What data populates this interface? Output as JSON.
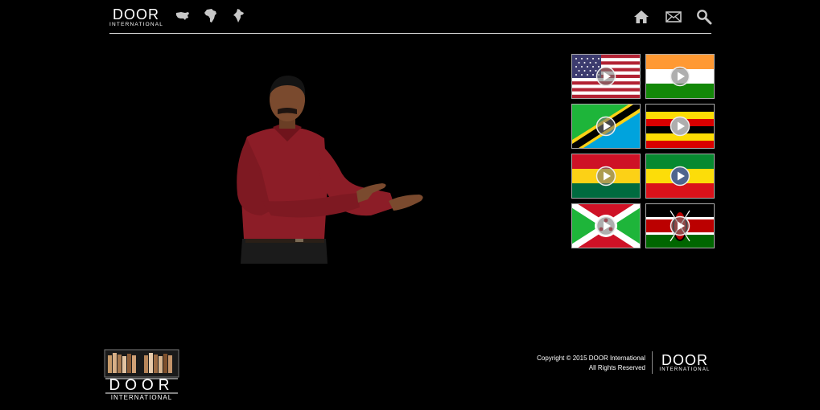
{
  "header": {
    "brand": {
      "name": "DOOR",
      "sub": "INTERNATIONAL"
    },
    "region_nav": [
      {
        "icon": "usa-map-icon"
      },
      {
        "icon": "africa-map-icon"
      },
      {
        "icon": "india-map-icon"
      }
    ],
    "actions": [
      {
        "icon": "home-icon"
      },
      {
        "icon": "mail-icon"
      },
      {
        "icon": "search-icon"
      }
    ]
  },
  "presenter": {
    "icon": "sign-language-presenter-image"
  },
  "flags": [
    {
      "icon": "usa-flag"
    },
    {
      "icon": "india-flag"
    },
    {
      "icon": "tanzania-flag"
    },
    {
      "icon": "uganda-flag"
    },
    {
      "icon": "ghana-flag"
    },
    {
      "icon": "ethiopia-flag"
    },
    {
      "icon": "burundi-flag"
    },
    {
      "icon": "kenya-flag"
    }
  ],
  "footer": {
    "logo": {
      "name": "DOOR",
      "sub": "INTERNATIONAL"
    },
    "copyright": "Copyright © 2015 DOOR International",
    "rights": "All Rights Reserved",
    "brand": {
      "name": "DOOR",
      "sub": "INTERNATIONAL"
    }
  },
  "colors": {
    "background": "#000000",
    "text": "#ffffff",
    "rule": "#d9d9d9",
    "icon": "#c8c8c8"
  }
}
